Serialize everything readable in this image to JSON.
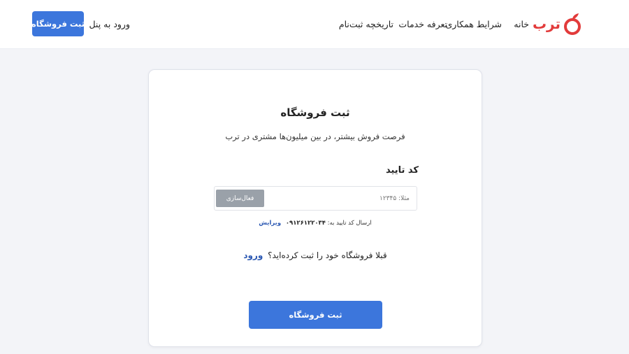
{
  "header": {
    "brand": "ترب",
    "nav": [
      "خانه",
      "شرایط همکاری",
      "تعرفه خدمات",
      "تاریخچه ثبت‌نام"
    ],
    "login_label": "ورود به پنل",
    "cta_label": "ثبت فروشگاه"
  },
  "form": {
    "title": "ثبت فروشگاه",
    "subtitle": "فرصت فروش بیشتر، در بین میلیون‌ها مشتری در ترب",
    "code_label": "کد تایید",
    "code_placeholder": "مثلا: ۱۲۳۴۵",
    "verify_label": "فعال‌سازی",
    "sent_text": "ارسال کد تایید به:",
    "sent_phone": "۰۹۱۲۶۱۲۲۰۳۴",
    "edit_label": "ویرایش",
    "already_text": "قبلا فروشگاه خود را ثبت کرده‌اید؟",
    "login_label": "ورود",
    "submit_label": "ثبت فروشگاه"
  },
  "colors": {
    "primary": "#3c76dc",
    "brand": "#e23b3b",
    "link": "#2c59b3",
    "disabled": "#9aa1a9",
    "background": "#f3f4f8"
  },
  "icons": {
    "logo": "torob-logo-icon"
  }
}
